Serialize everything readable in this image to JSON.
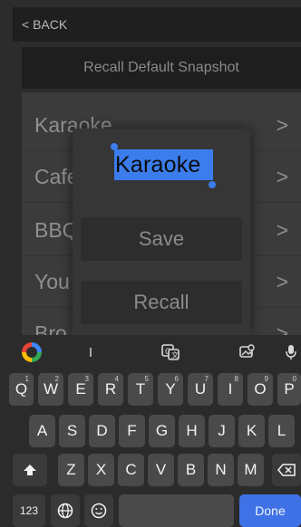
{
  "topbar": {
    "back_label": "< BACK"
  },
  "snapshot": {
    "label": "Recall Default Snapshot"
  },
  "list": {
    "items": [
      {
        "label": "Karaoke",
        "chevron": ">"
      },
      {
        "label": "Cafe",
        "chevron": ">"
      },
      {
        "label": "BBQ",
        "chevron": ">"
      },
      {
        "label": "You",
        "chevron": ">"
      },
      {
        "label": "Bro",
        "chevron": ">"
      }
    ]
  },
  "popup": {
    "name_value": "Karaoke",
    "save_label": "Save",
    "recall_label": "Recall"
  },
  "keyboard": {
    "suggest": {
      "cursor_label": "I"
    },
    "row1": [
      {
        "k": "Q",
        "h": "1"
      },
      {
        "k": "W",
        "h": "2"
      },
      {
        "k": "E",
        "h": "3"
      },
      {
        "k": "R",
        "h": "4"
      },
      {
        "k": "T",
        "h": "5"
      },
      {
        "k": "Y",
        "h": "6"
      },
      {
        "k": "U",
        "h": "7"
      },
      {
        "k": "I",
        "h": "8"
      },
      {
        "k": "O",
        "h": "9"
      },
      {
        "k": "P",
        "h": "0"
      }
    ],
    "row2": [
      "A",
      "S",
      "D",
      "F",
      "G",
      "H",
      "J",
      "K",
      "L"
    ],
    "row3": [
      "Z",
      "X",
      "C",
      "V",
      "B",
      "N",
      "M"
    ],
    "numbers_label": "123",
    "done_label": "Done"
  },
  "colors": {
    "accent": "#3b7ded",
    "done_key": "#3f72e6",
    "keyboard_bg": "#2b2b2b",
    "key_bg": "#4a4a4a"
  }
}
